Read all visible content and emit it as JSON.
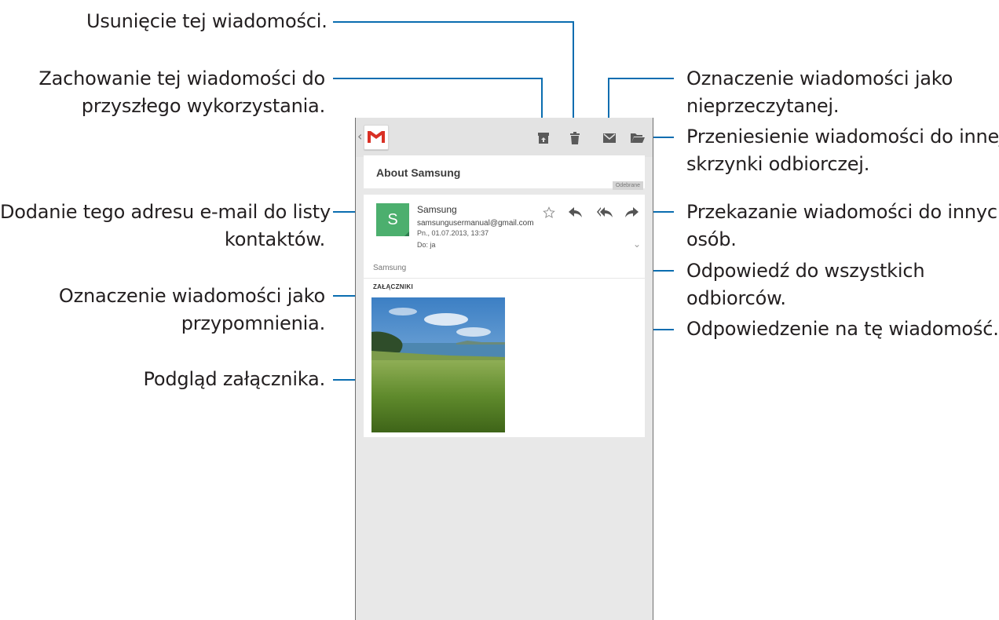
{
  "callouts": {
    "delete": "Usunięcie tej wiadomości.",
    "archive": [
      "Zachowanie tej wiadomości do",
      "przyszłego wykorzystania."
    ],
    "add_contact": [
      "Dodanie tego adresu e-mail do listy",
      "kontaktów."
    ],
    "star": [
      "Oznaczenie wiadomości jako",
      "przypomnienia."
    ],
    "preview": "Podgląd załącznika.",
    "mark_unread": [
      "Oznaczenie wiadomości jako",
      "nieprzeczytanej."
    ],
    "move": [
      "Przeniesienie wiadomości do innej",
      "skrzynki odbiorczej."
    ],
    "forward": [
      "Przekazanie wiadomości do innych",
      "osób."
    ],
    "reply_all": [
      "Odpowiedź do wszystkich",
      "odbiorców."
    ],
    "reply": "Odpowiedzenie na tę wiadomość."
  },
  "email": {
    "subject": "About Samsung",
    "label": "Odebrane",
    "avatar_letter": "S",
    "sender_name": "Samsung",
    "sender_email": "samsungusermanual@gmail.com",
    "date": "Pn., 01.07.2013, 13:37",
    "to": "Do: ja",
    "body": "Samsung",
    "attachments_header": "ZAŁĄCZNIKI"
  },
  "icons": {
    "back": "chevron-left-icon",
    "app": "gmail-logo",
    "archive": "archive-icon",
    "delete": "trash-icon",
    "mark_unread": "envelope-icon",
    "move": "folder-icon",
    "star": "star-outline-icon",
    "reply": "reply-icon",
    "reply_all": "reply-all-icon",
    "forward": "forward-icon",
    "expand": "chevron-down-icon"
  },
  "colors": {
    "leader_line": "#0a6db0",
    "avatar": "#4caf6e",
    "gmail_red": "#d93025"
  }
}
